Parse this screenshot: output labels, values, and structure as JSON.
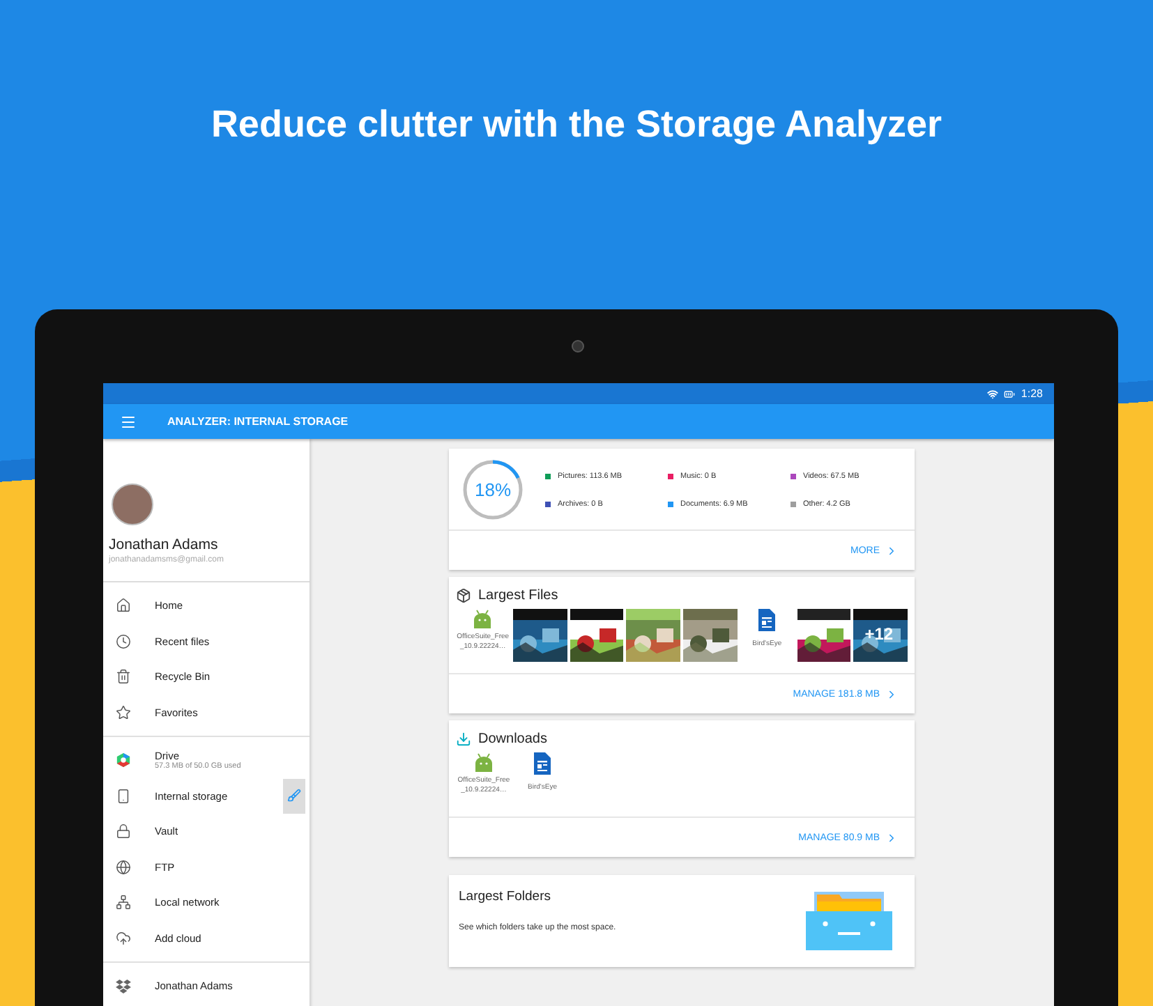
{
  "headline": "Reduce clutter with the Storage Analyzer",
  "status_bar": {
    "time": "1:28"
  },
  "app_bar": {
    "title": "ANALYZER: INTERNAL STORAGE"
  },
  "account": {
    "name": "Jonathan Adams",
    "email": "jonathanadamsms@gmail.com"
  },
  "nav_groups": [
    [
      {
        "kind": "home",
        "label": "Home"
      },
      {
        "kind": "clock",
        "label": "Recent files"
      },
      {
        "kind": "trash",
        "label": "Recycle Bin"
      },
      {
        "kind": "star",
        "label": "Favorites"
      }
    ],
    [
      {
        "kind": "drive",
        "label": "Drive",
        "subtitle": "57.3 MB of 50.0 GB used"
      },
      {
        "kind": "phone",
        "label": "Internal storage",
        "analyzer": true
      },
      {
        "kind": "lock",
        "label": "Vault"
      },
      {
        "kind": "globe",
        "label": "FTP"
      },
      {
        "kind": "network",
        "label": "Local network"
      },
      {
        "kind": "cloud",
        "label": "Add cloud"
      }
    ],
    [
      {
        "kind": "dropbox",
        "label": "Jonathan Adams"
      }
    ]
  ],
  "storage": {
    "percent": "18%",
    "level": 0.18,
    "more": "MORE",
    "legend": [
      {
        "label": "Pictures: 113.6 MB",
        "color": "#0f9d58"
      },
      {
        "label": "Music: 0 B",
        "color": "#e91e63"
      },
      {
        "label": "Videos: 67.5 MB",
        "color": "#ab47bc"
      },
      {
        "label": "Archives: 0 B",
        "color": "#3f51b5"
      },
      {
        "label": "Documents: 6.9 MB",
        "color": "#2196f3"
      },
      {
        "label": "Other: 4.2 GB",
        "color": "#9e9e9e"
      }
    ]
  },
  "largest_files": {
    "title": "Largest Files",
    "action": "MANAGE 181.8 MB",
    "items": [
      {
        "kind": "apk",
        "label": "OfficeSuite_Free_10.9.22224…"
      },
      {
        "kind": "picture"
      },
      {
        "kind": "picture"
      },
      {
        "kind": "picture"
      },
      {
        "kind": "picture"
      },
      {
        "kind": "doc",
        "label": "Bird'sEye"
      },
      {
        "kind": "picture"
      },
      {
        "kind": "picture",
        "overlay": "+12"
      }
    ]
  },
  "downloads": {
    "title": "Downloads",
    "action": "MANAGE 80.9 MB",
    "items": [
      {
        "kind": "apk",
        "label": "OfficeSuite_Free_10.9.22224…"
      },
      {
        "kind": "doc",
        "label": "Bird'sEye"
      }
    ]
  },
  "largest_folders": {
    "title": "Largest Folders",
    "description": "See which folders take up the most space."
  }
}
